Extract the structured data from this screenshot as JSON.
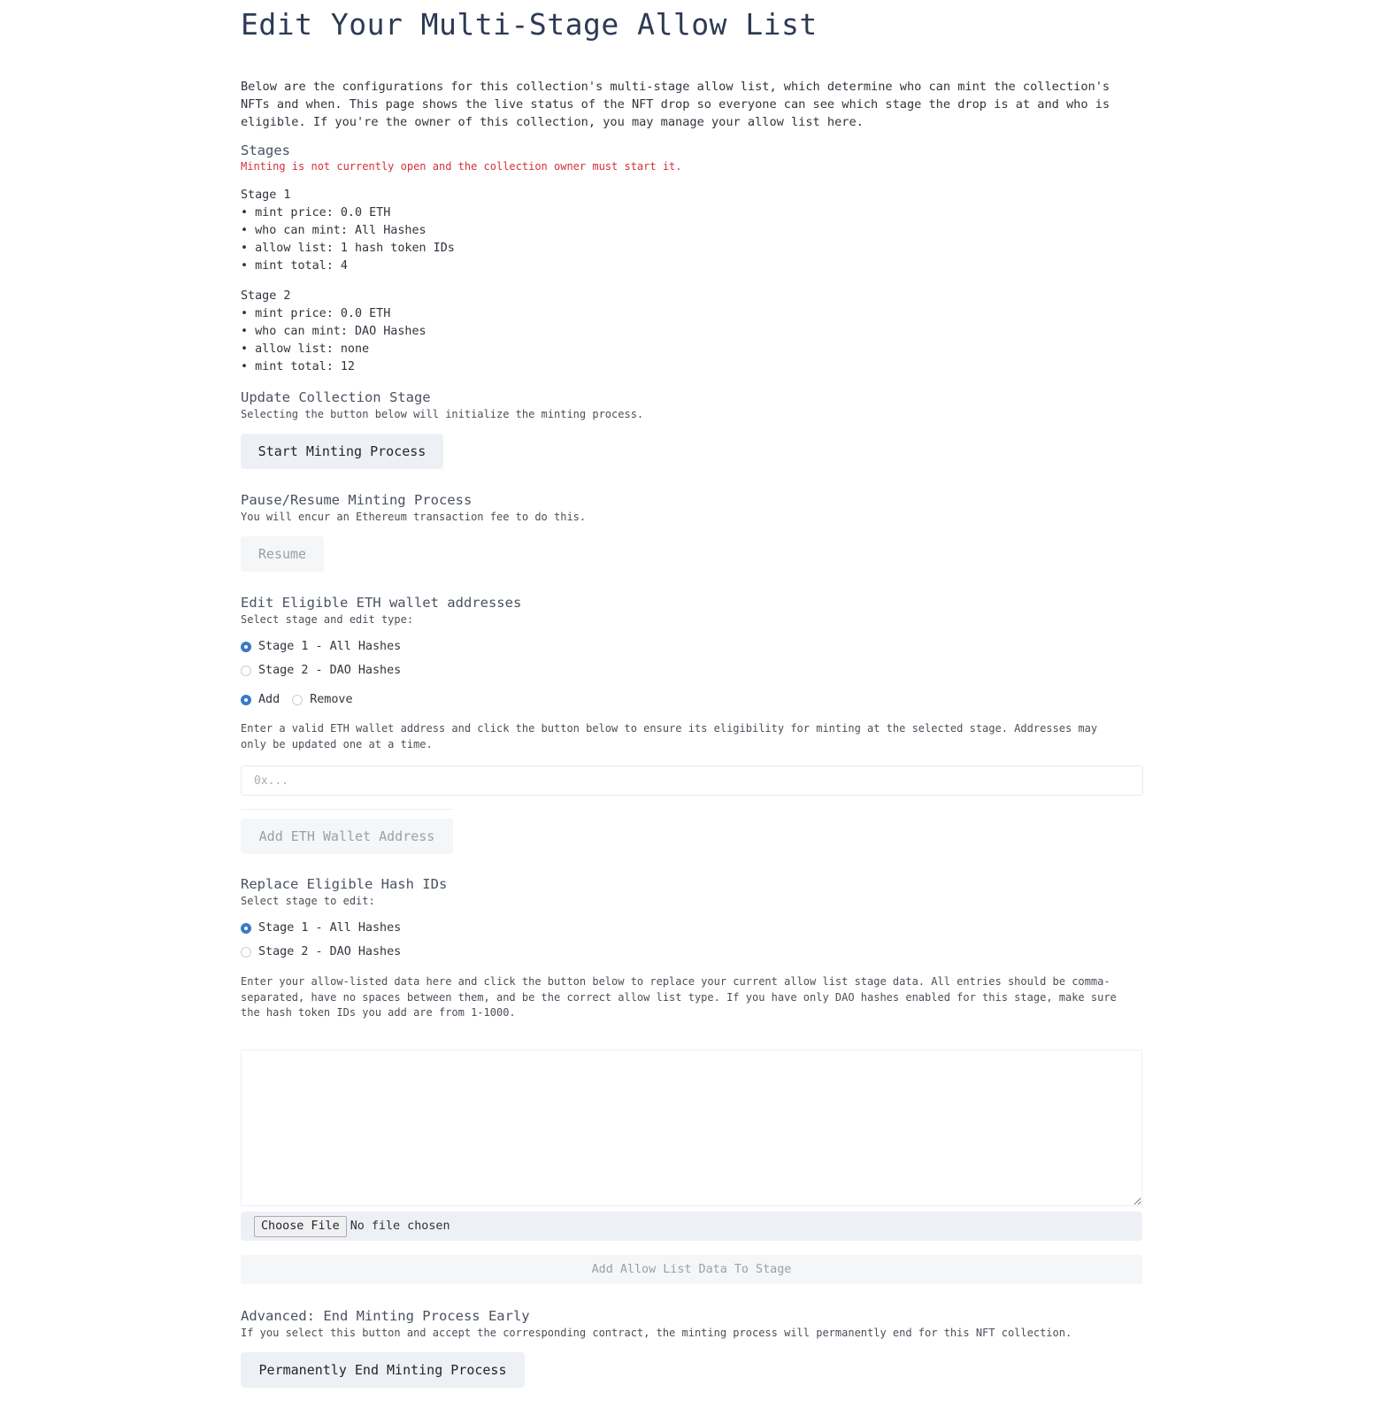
{
  "page": {
    "title": "Edit Your Multi-Stage Allow List",
    "intro": "Below are the configurations for this collection's multi-stage allow list, which determine who can mint the collection's NFTs and when. This page shows the live status of the NFT drop so everyone can see which stage the drop is at and who is eligible. If you're the owner of this collection, you may manage your allow list here."
  },
  "stages": {
    "title": "Stages",
    "warning": "Minting is not currently open and the collection owner must start it.",
    "list": [
      {
        "name": "Stage 1",
        "mint_price": "• mint price: 0.0 ETH",
        "who_can_mint": "• who can mint: All Hashes",
        "allow_list": "• allow list: 1 hash token IDs",
        "mint_total": "• mint total: 4"
      },
      {
        "name": "Stage 2",
        "mint_price": "• mint price: 0.0 ETH",
        "who_can_mint": "• who can mint: DAO Hashes",
        "allow_list": "• allow list: none",
        "mint_total": "• mint total: 12"
      }
    ]
  },
  "update_stage": {
    "title": "Update Collection Stage",
    "subtitle": "Selecting the button below will initialize the minting process.",
    "button": "Start Minting Process"
  },
  "pause_resume": {
    "title": "Pause/Resume Minting Process",
    "subtitle": "You will encur an Ethereum transaction fee to do this.",
    "button": "Resume"
  },
  "edit_wallets": {
    "title": "Edit Eligible ETH wallet addresses",
    "subtitle": "Select stage and edit type:",
    "stage_options": [
      "Stage 1 - All Hashes",
      "Stage 2 - DAO Hashes"
    ],
    "selected_stage": 0,
    "type_options": [
      "Add",
      "Remove"
    ],
    "selected_type": 0,
    "help": "Enter a valid ETH wallet address and click the button below to ensure its eligibility for minting at the selected stage. Addresses may only be updated one at a time.",
    "input_placeholder": "0x...",
    "input_value": "",
    "button": "Add ETH Wallet Address"
  },
  "replace_hash": {
    "title": "Replace Eligible Hash IDs",
    "subtitle": "Select stage to edit:",
    "stage_options": [
      "Stage 1 - All Hashes",
      "Stage 2 - DAO Hashes"
    ],
    "selected_stage": 0,
    "help": "Enter your allow-listed data here and click the button below to replace your current allow list stage data. All entries should be comma-separated, have no spaces between them, and be the correct allow list type. If you have only DAO hashes enabled for this stage, make sure the hash token IDs you add are from 1-1000.",
    "textarea_value": "",
    "file_button": "Choose File",
    "file_status": "No file chosen",
    "button": "Add Allow List Data To Stage"
  },
  "end_early": {
    "title": "Advanced: End Minting Process Early",
    "subtitle": "If you select this button and accept the corresponding contract, the minting process will permanently end for this NFT collection.",
    "button": "Permanently End Minting Process"
  },
  "colors": {
    "accent": "#3b79c7",
    "warning": "#d6303a",
    "button_bg": "#edf0f4",
    "title": "#2c3a55"
  }
}
